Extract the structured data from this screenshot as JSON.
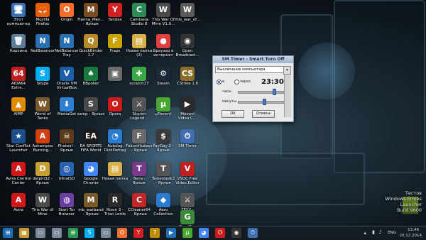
{
  "desktop": {
    "icons": [
      {
        "label": "Этот\nкомпьютер",
        "glyph": "🖥",
        "color": "#3b6fb6",
        "col": 0,
        "row": 0
      },
      {
        "label": "Mozilla\nFirefox",
        "glyph": "🦊",
        "color": "#e66000",
        "col": 1,
        "row": 0
      },
      {
        "label": "Origin",
        "glyph": "O",
        "color": "#f56c2d",
        "col": 2,
        "row": 0
      },
      {
        "label": "Fianna_Men...\n- Ярлык",
        "glyph": "M",
        "color": "#7a4b21",
        "col": 3,
        "row": 0
      },
      {
        "label": "Yandex",
        "glyph": "Y",
        "color": "#d21f1f",
        "col": 4,
        "row": 0
      },
      {
        "label": "Camtasia\nStudio 8",
        "glyph": "C",
        "color": "#2e8b57",
        "col": 5,
        "row": 0
      },
      {
        "label": "This War Of\nMine V1.0...",
        "glyph": "W",
        "color": "#4a4a4a",
        "col": 6,
        "row": 0
      },
      {
        "label": "this_war_of...",
        "glyph": "W",
        "color": "#5a5a5a",
        "col": 7,
        "row": 0
      },
      {
        "label": "Корзина",
        "glyph": "🗑",
        "color": "#5c7d99",
        "col": 0,
        "row": 1
      },
      {
        "label": "NetBalancer",
        "glyph": "N",
        "color": "#2a6fb0",
        "col": 1,
        "row": 1
      },
      {
        "label": "NetBalancer\nTray",
        "glyph": "N",
        "color": "#2a6fb0",
        "col": 2,
        "row": 1
      },
      {
        "label": "QuickBinder\n1.7",
        "glyph": "Q",
        "color": "#b58b2a",
        "col": 3,
        "row": 1
      },
      {
        "label": "Fraps",
        "glyph": "F",
        "color": "#c9a400",
        "col": 4,
        "row": 1
      },
      {
        "label": "Новая папка\n(2)",
        "glyph": "▤",
        "color": "#d8b04a",
        "col": 5,
        "row": 1
      },
      {
        "label": "Браузер в\nинтернет",
        "glyph": "●",
        "color": "#e04040",
        "col": 6,
        "row": 1
      },
      {
        "label": "Open\nBroadcast...",
        "glyph": "◉",
        "color": "#333333",
        "col": 7,
        "row": 1
      },
      {
        "label": "AIDA64\nExtre...",
        "glyph": "64",
        "color": "#c22020",
        "col": 0,
        "row": 2
      },
      {
        "label": "Skype",
        "glyph": "S",
        "color": "#00aff0",
        "col": 1,
        "row": 2
      },
      {
        "label": "Oracle VM\nVirtualBox",
        "glyph": "V",
        "color": "#1c5da8",
        "col": 2,
        "row": 2
      },
      {
        "label": "BBpoker",
        "glyph": "♠",
        "color": "#1a7a3c",
        "col": 3,
        "row": 2
      },
      {
        "label": "",
        "glyph": "▣",
        "color": "#6b6b6b",
        "col": 4,
        "row": 2
      },
      {
        "label": "scratch27",
        "glyph": "✚",
        "color": "#3aa845",
        "col": 5,
        "row": 2
      },
      {
        "label": "Steam",
        "glyph": "⚙",
        "color": "#1b2838",
        "col": 6,
        "row": 2
      },
      {
        "label": "CStrike 1.6",
        "glyph": "CS",
        "color": "#8a6d2a",
        "col": 7,
        "row": 2
      },
      {
        "label": "AIMP",
        "glyph": "▲",
        "color": "#e08a00",
        "col": 0,
        "row": 3
      },
      {
        "label": "World of\nTanks",
        "glyph": "W",
        "color": "#7a5a2a",
        "col": 1,
        "row": 3
      },
      {
        "label": "MediaGet",
        "glyph": "⬇",
        "color": "#2f7fd0",
        "col": 2,
        "row": 3
      },
      {
        "label": "samp - Ярлык",
        "glyph": "S",
        "color": "#4a4a4a",
        "col": 3,
        "row": 3
      },
      {
        "label": "Opera",
        "glyph": "O",
        "color": "#cc1b1b",
        "col": 4,
        "row": 3
      },
      {
        "label": "Skyrim\nLegend...",
        "glyph": "⚔",
        "color": "#555555",
        "col": 5,
        "row": 3
      },
      {
        "label": "µTorrent",
        "glyph": "µ",
        "color": "#4aa832",
        "col": 6,
        "row": 3
      },
      {
        "label": "Movavi\nVideo C...",
        "glyph": "▶",
        "color": "#2b2b2b",
        "col": 7,
        "row": 3
      },
      {
        "label": "Star Conflict\nLauncher",
        "glyph": "★",
        "color": "#1e4f8a",
        "col": 0,
        "row": 4
      },
      {
        "label": "Ashampoo\nBurning...",
        "glyph": "A",
        "color": "#d04010",
        "col": 1,
        "row": 4
      },
      {
        "label": "Pirates! - Ярлык",
        "glyph": "☠",
        "color": "#5a3a1a",
        "col": 2,
        "row": 4
      },
      {
        "label": "EA SPORTS\nFIFA World",
        "glyph": "EA",
        "color": "#1a1a1a",
        "col": 3,
        "row": 4
      },
      {
        "label": "Autolog\nDiskDefrag",
        "glyph": "◔",
        "color": "#2a7ad0",
        "col": 4,
        "row": 4
      },
      {
        "label": "FalconHubaer\n- Ярлык",
        "glyph": "F",
        "color": "#6a6a6a",
        "col": 5,
        "row": 4
      },
      {
        "label": "PayDay 2 -\nЯрлык",
        "glyph": "$",
        "color": "#3a3a3a",
        "col": 6,
        "row": 4
      },
      {
        "label": "SM Timer",
        "glyph": "⏱",
        "color": "#3f6fb0",
        "col": 7,
        "row": 4
      },
      {
        "label": "Avira Control\nCenter",
        "glyph": "A",
        "color": "#d01818",
        "col": 0,
        "row": 5
      },
      {
        "label": "delphi32 -\nЯрлык",
        "glyph": "D",
        "color": "#c8a030",
        "col": 1,
        "row": 5
      },
      {
        "label": "UltraISO",
        "glyph": "◎",
        "color": "#2a62b0",
        "col": 2,
        "row": 5
      },
      {
        "label": "Google\nChrome",
        "glyph": "◕",
        "color": "#4285f4",
        "col": 3,
        "row": 5
      },
      {
        "label": "Новая папка",
        "glyph": "▤",
        "color": "#d8b04a",
        "col": 4,
        "row": 5
      },
      {
        "label": "Terra -\nЯрлык",
        "glyph": "T",
        "color": "#7a3a8a",
        "col": 5,
        "row": 5
      },
      {
        "label": "Testerdesk2\n- Ярлык",
        "glyph": "T",
        "color": "#555555",
        "col": 6,
        "row": 5
      },
      {
        "label": "VSDC Free\nVideo Editor",
        "glyph": "V",
        "color": "#c02020",
        "col": 7,
        "row": 5
      },
      {
        "label": "Avira",
        "glyph": "A",
        "color": "#d01818",
        "col": 0,
        "row": 6
      },
      {
        "label": "This War of\nMine",
        "glyph": "W",
        "color": "#4a4a4a",
        "col": 1,
        "row": 6
      },
      {
        "label": "Start Tor\nBrowser",
        "glyph": "◍",
        "color": "#6b3fa0",
        "col": 2,
        "row": 6
      },
      {
        "label": "mb_warband\n- Ярлык",
        "glyph": "M",
        "color": "#7a5a2a",
        "col": 3,
        "row": 6
      },
      {
        "label": "Risen 3 -\nTitan Lords",
        "glyph": "R",
        "color": "#2a2a2a",
        "col": 4,
        "row": 6
      },
      {
        "label": "CCleaner64\n- Ярлык",
        "glyph": "C",
        "color": "#c02828",
        "col": 5,
        "row": 6
      },
      {
        "label": "Aero\nCollection",
        "glyph": "◆",
        "color": "#2a7ad0",
        "col": 6,
        "row": 6
      },
      {
        "label": "TESV -\nЯрлык",
        "glyph": "⚔",
        "color": "#555555",
        "col": 7,
        "row": 6
      },
      {
        "label": "GeedFan",
        "glyph": "G",
        "color": "#3a8a3a",
        "col": 7,
        "row": 6
      }
    ]
  },
  "dialog": {
    "title": "SM Timer - Smart Turn Off",
    "action": "Выключение компьютера",
    "mode_in": "в",
    "mode_after": "через",
    "time": "23:30",
    "hours_label": "часы",
    "minutes_label": "минуты",
    "ok": "OK",
    "cancel": "Отмена",
    "hour_fraction": 0.78,
    "minute_fraction": 0.55
  },
  "taskbar": {
    "apps": [
      {
        "name": "windows-start",
        "glyph": "⊞",
        "color": "#1e6fb8"
      },
      {
        "name": "file-explorer",
        "glyph": "▦",
        "color": "#c99a2e"
      },
      {
        "name": "documents",
        "glyph": "▭",
        "color": "#7a8a9a"
      },
      {
        "name": "documents-2",
        "glyph": "▭",
        "color": "#7a8a9a"
      },
      {
        "name": "store",
        "glyph": "⊞",
        "color": "#2e9b4e"
      },
      {
        "name": "skype",
        "glyph": "S",
        "color": "#00aff0"
      },
      {
        "name": "files",
        "glyph": "▭",
        "color": "#7a8a9a"
      },
      {
        "name": "origin",
        "glyph": "O",
        "color": "#f56c2d"
      },
      {
        "name": "yandex",
        "glyph": "Y",
        "color": "#d21f1f"
      },
      {
        "name": "aimp",
        "glyph": "7",
        "color": "#c08a00"
      },
      {
        "name": "media-player",
        "glyph": "▶",
        "color": "#1e6fb8"
      },
      {
        "name": "utorrent",
        "glyph": "µ",
        "color": "#4aa832"
      },
      {
        "name": "chrome",
        "glyph": "◕",
        "color": "#4285f4"
      },
      {
        "name": "opera",
        "glyph": "O",
        "color": "#cc1b1b"
      },
      {
        "name": "obs",
        "glyph": "◉",
        "color": "#333333"
      },
      {
        "name": "sm-timer",
        "glyph": "⏱",
        "color": "#3f6fb0"
      }
    ],
    "lang": "ENG",
    "clock_time": "13:46",
    "clock_date": "20.12.2014"
  },
  "watermark": {
    "line1": "Тестов",
    "line2": "Windows Ermes",
    "line3": "Launcher",
    "line4": "Build 9600"
  }
}
